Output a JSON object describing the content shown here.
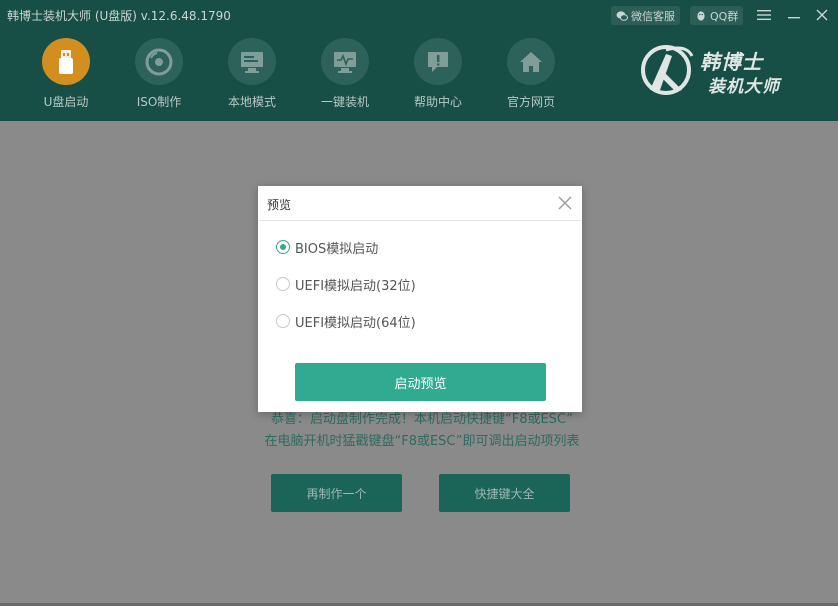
{
  "titlebar": {
    "app_title": "韩博士装机大师 (U盘版) v.12.6.48.1790",
    "service_label": "微信客服",
    "qq_label": "QQ群",
    "menu_icon": "hamburger-icon",
    "minimize_icon": "minimize-icon",
    "close_icon": "close-icon"
  },
  "nav": {
    "items": [
      {
        "label": "U盘启动",
        "icon": "usb-drive-icon",
        "active": true
      },
      {
        "label": "ISO制作",
        "icon": "disc-icon",
        "active": false
      },
      {
        "label": "本地模式",
        "icon": "monitor-icon",
        "active": false
      },
      {
        "label": "一键装机",
        "icon": "system-monitor-icon",
        "active": false
      },
      {
        "label": "帮助中心",
        "icon": "help-chat-icon",
        "active": false
      },
      {
        "label": "官方网页",
        "icon": "home-icon",
        "active": false
      }
    ]
  },
  "logo": {
    "line1": "韩博士",
    "line2": "装机大师"
  },
  "main": {
    "message_line1": "恭喜：启动盘制作完成！本机启动快捷键“F8或ESC”",
    "message_line2": "在电脑开机时猛戳键盘“F8或ESC”即可调出启动项列表",
    "remake_button": "再制作一个",
    "hotkeys_button": "快捷键大全"
  },
  "dialog": {
    "title": "预览",
    "options": [
      {
        "label": "BIOS模拟启动",
        "checked": true
      },
      {
        "label": "UEFI模拟启动(32位)",
        "checked": false
      },
      {
        "label": "UEFI模拟启动(64位)",
        "checked": false
      }
    ],
    "start_button": "启动预览"
  },
  "colors": {
    "header_bg": "#174e45",
    "accent": "#30ab91",
    "active_nav": "#d28f20"
  }
}
